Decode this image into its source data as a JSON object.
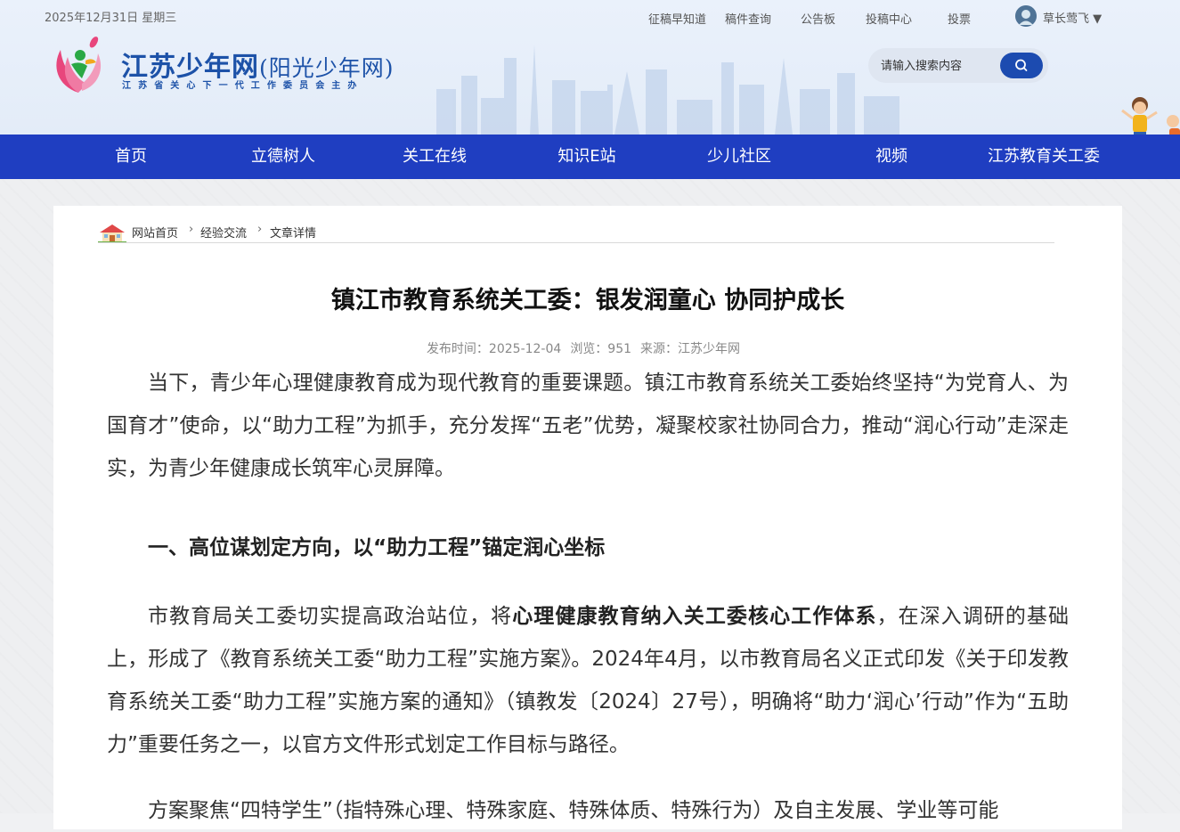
{
  "header": {
    "date": "2025年12月31日 星期三",
    "top_links": [
      "征稿早知道",
      "稿件查询",
      "公告板",
      "投稿中心",
      "投票"
    ],
    "user_name": "草长莺飞 ▼",
    "site_title": "江苏少年网",
    "site_title_paren": "(阳光少年网)",
    "site_subtitle": "江苏省关心下一代工作委员会主办",
    "search_placeholder": "请输入搜索内容"
  },
  "nav": {
    "items": [
      "首页",
      "立德树人",
      "关工在线",
      "知识E站",
      "少儿社区",
      "视频",
      "江苏教育关工委"
    ]
  },
  "breadcrumb": {
    "items": [
      "网站首页",
      "经验交流",
      "文章详情"
    ]
  },
  "article": {
    "title": "镇江市教育系统关工委：银发润童心 协同护成长",
    "publish_time": "发布时间：2025-12-04",
    "views": "浏览：951",
    "source": "来源：江苏少年网",
    "para1": "当下，青少年心理健康教育成为现代教育的重要课题。镇江市教育系统关工委始终坚持“为党育人、为国育才”使命，以“助力工程”为抓手，充分发挥“五老”优势，凝聚校家社协同合力，推动“润心行动”走深走实，为青少年健康成长筑牢心灵屏障。",
    "section1": "一、高位谋划定方向，以“助力工程”锚定润心坐标",
    "para2_before": "市教育局关工委切实提高政治站位，将",
    "para2_bold": "心理健康教育纳入关工委核心工作体系",
    "para2_after": "，在深入调研的基础上，形成了《教育系统关工委“助力工程”实施方案》。2024年4月，以市教育局名义正式印发《关于印发教育系统关工委“助力工程”实施方案的通知》（镇教发〔2024〕27号），明确将“助力‘润心’行动”作为“五助力”重要任务之一，以官方文件形式划定工作目标与路径。",
    "para3": "方案聚焦“四特学生”（指特殊心理、特殊家庭、特殊体质、特殊行为）及自主发展、学业等可能"
  }
}
